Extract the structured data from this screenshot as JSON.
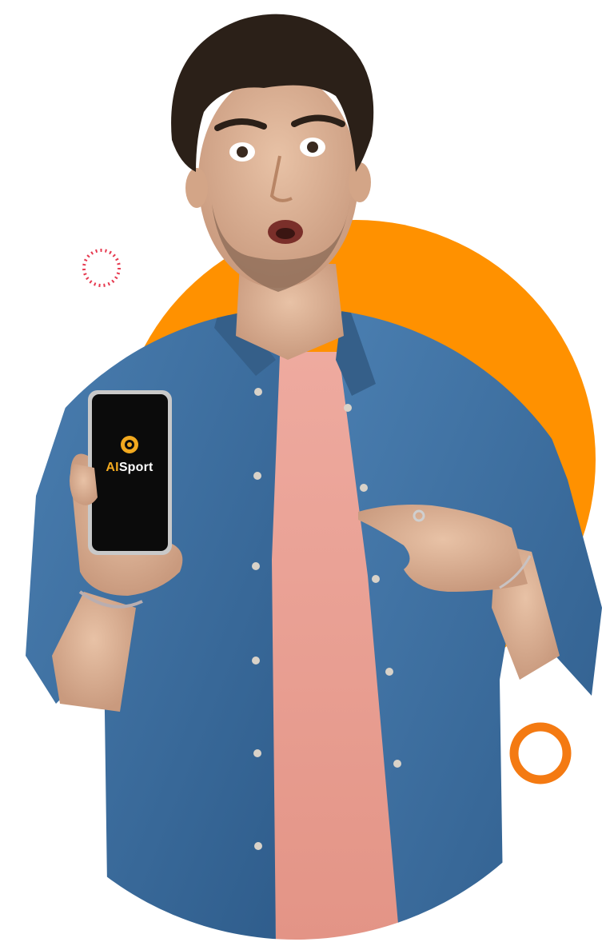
{
  "phone": {
    "logo_prefix": "AI",
    "logo_suffix": "Sport"
  },
  "colors": {
    "accent_orange": "#ff9100",
    "ring_orange": "#f47a12",
    "dot_ring_red": "#e6394f",
    "denim": "#3d6f9e",
    "tshirt_pink": "#e8a196",
    "phone_screen": "#0b0b0b",
    "logo_gold": "#f2a91f"
  },
  "icons": {
    "app_logo": "ball-logo-icon",
    "decor_dotted_ring": "dotted-ring-icon",
    "decor_orange_ring": "orange-ring-icon"
  }
}
